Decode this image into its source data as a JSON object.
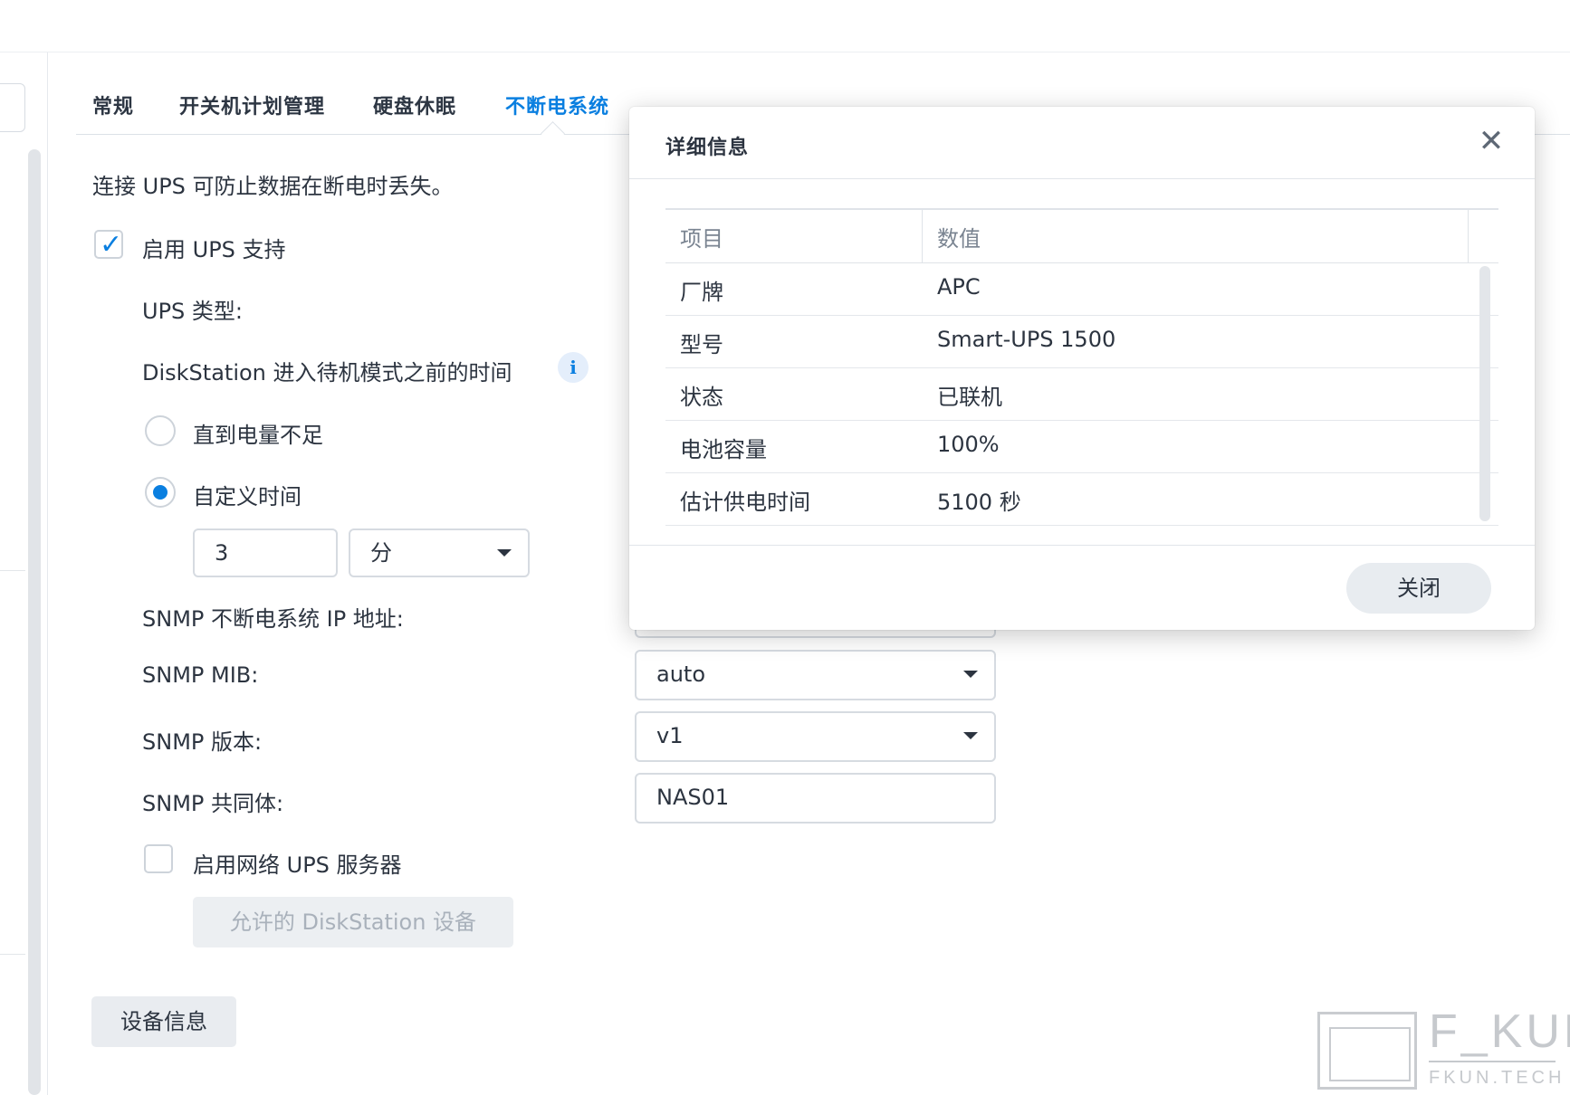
{
  "tabs": [
    {
      "label": "常规"
    },
    {
      "label": "开关机计划管理"
    },
    {
      "label": "硬盘休眠"
    },
    {
      "label": "不断电系统"
    }
  ],
  "ups": {
    "description": "连接 UPS 可防止数据在断电时丢失。",
    "enable_label": "启用 UPS 支持",
    "enable_checked": true,
    "type_label": "UPS 类型:",
    "standby_label": "DiskStation 进入待机模式之前的时间",
    "info_icon": "i",
    "option_until_low": "直到电量不足",
    "option_custom": "自定义时间",
    "custom_selected": true,
    "time_value": "3",
    "time_unit": "分",
    "snmp_ip_label": "SNMP 不断电系统 IP 地址:",
    "snmp_mib_label": "SNMP MIB:",
    "snmp_mib_value": "auto",
    "snmp_version_label": "SNMP 版本:",
    "snmp_version_value": "v1",
    "snmp_community_label": "SNMP 共同体:",
    "snmp_community_value": "NAS01",
    "network_ups_label": "启用网络 UPS 服务器",
    "network_ups_checked": false,
    "allowed_devices_button": "允许的 DiskStation 设备",
    "device_info_button": "设备信息"
  },
  "modal": {
    "title": "详细信息",
    "close_glyph": "✕",
    "columns": [
      "项目",
      "数值"
    ],
    "rows": [
      {
        "item": "厂牌",
        "value": "APC"
      },
      {
        "item": "型号",
        "value": "Smart-UPS 1500"
      },
      {
        "item": "状态",
        "value": "已联机"
      },
      {
        "item": "电池容量",
        "value": "100%"
      },
      {
        "item": "估计供电时间",
        "value": "5100 秒"
      }
    ],
    "close_button": "关闭"
  },
  "watermark": {
    "name": "F_KUN",
    "url": "FKUN.TECH"
  },
  "colors": {
    "accent": "#0a7fe0",
    "text": "#2c3440",
    "muted": "#7a8491"
  }
}
